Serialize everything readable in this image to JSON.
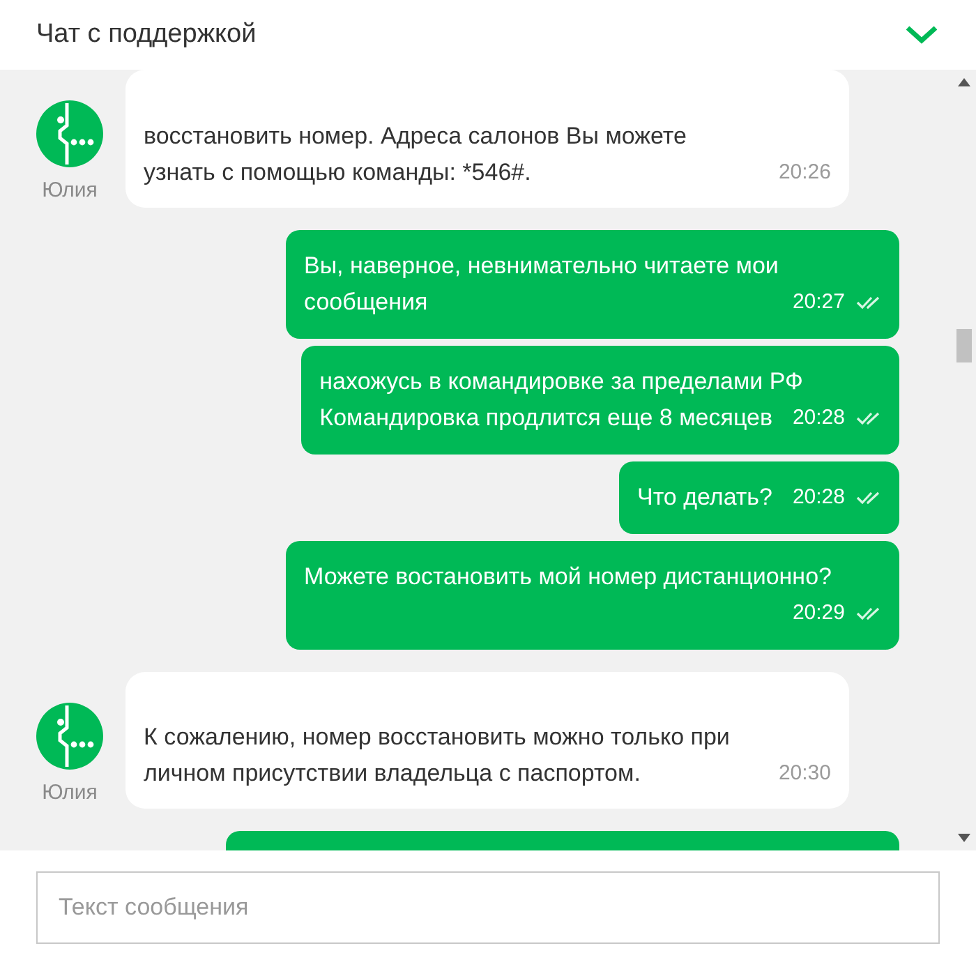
{
  "header": {
    "title": "Чат с поддержкой"
  },
  "messages": [
    {
      "kind": "incoming",
      "text": "восстановить номер. Адреса салонов Вы можете узнать с помощью команды: *546#.",
      "time": "20:26",
      "author": "Юлия"
    },
    {
      "kind": "outgoing",
      "text": "Вы, наверное, невнимательно читаете мои сообщения",
      "time": "20:27"
    },
    {
      "kind": "outgoing",
      "text": "нахожусь в командировке за пределами РФ\nКомандировка продлится еще 8 месяцев",
      "time": "20:28"
    },
    {
      "kind": "outgoing",
      "text": "Что делать?",
      "time": "20:28"
    },
    {
      "kind": "outgoing",
      "text": "Можете востановить мой номер дистанционно?",
      "time": "20:29"
    },
    {
      "kind": "incoming",
      "text": "К сожалению, номер восстановить можно только при личном присутствии владельца с паспортом.",
      "time": "20:30",
      "author": "Юлия"
    },
    {
      "kind": "outgoing"
    }
  ],
  "composer": {
    "placeholder": "Текст сообщения"
  }
}
